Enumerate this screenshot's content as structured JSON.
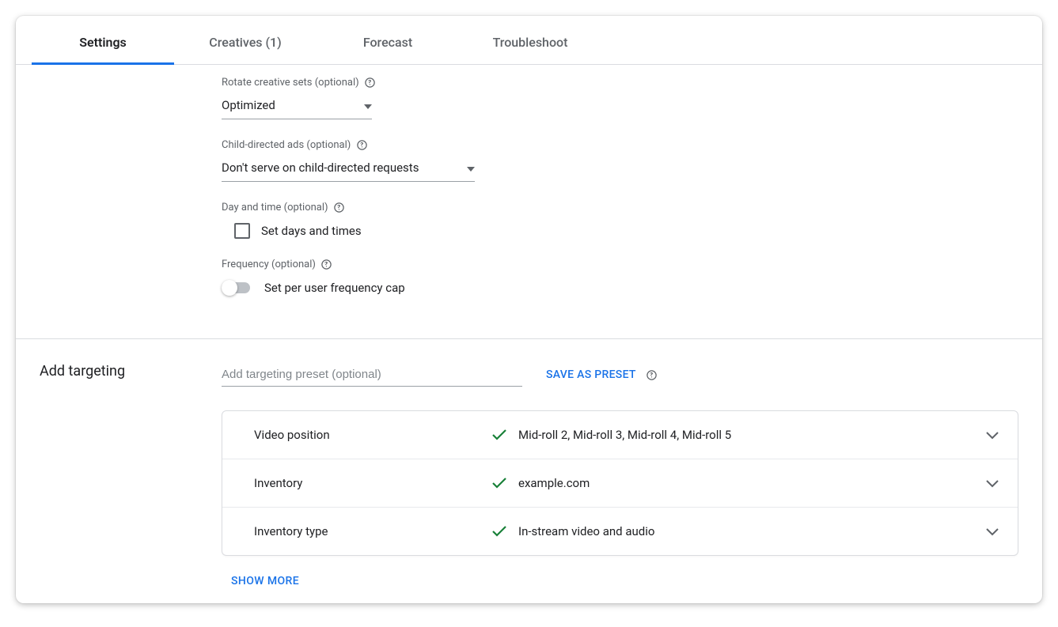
{
  "tabs": {
    "settings": "Settings",
    "creatives": "Creatives (1)",
    "forecast": "Forecast",
    "troubleshoot": "Troubleshoot"
  },
  "fields": {
    "rotate_label": "Rotate creative sets (optional)",
    "rotate_value": "Optimized",
    "child_label": "Child-directed ads (optional)",
    "child_value": "Don't serve on child-directed requests",
    "daytime_label": "Day and time (optional)",
    "daytime_checkbox": "Set days and times",
    "frequency_label": "Frequency (optional)",
    "frequency_toggle": "Set per user frequency cap"
  },
  "targeting": {
    "section_title": "Add targeting",
    "preset_placeholder": "Add targeting preset (optional)",
    "save_preset": "SAVE AS PRESET",
    "rows": [
      {
        "label": "Video position",
        "value": "Mid-roll 2, Mid-roll 3, Mid-roll 4, Mid-roll 5"
      },
      {
        "label": "Inventory",
        "value": "example.com"
      },
      {
        "label": "Inventory type",
        "value": "In-stream video and audio"
      }
    ],
    "show_more": "SHOW MORE"
  }
}
